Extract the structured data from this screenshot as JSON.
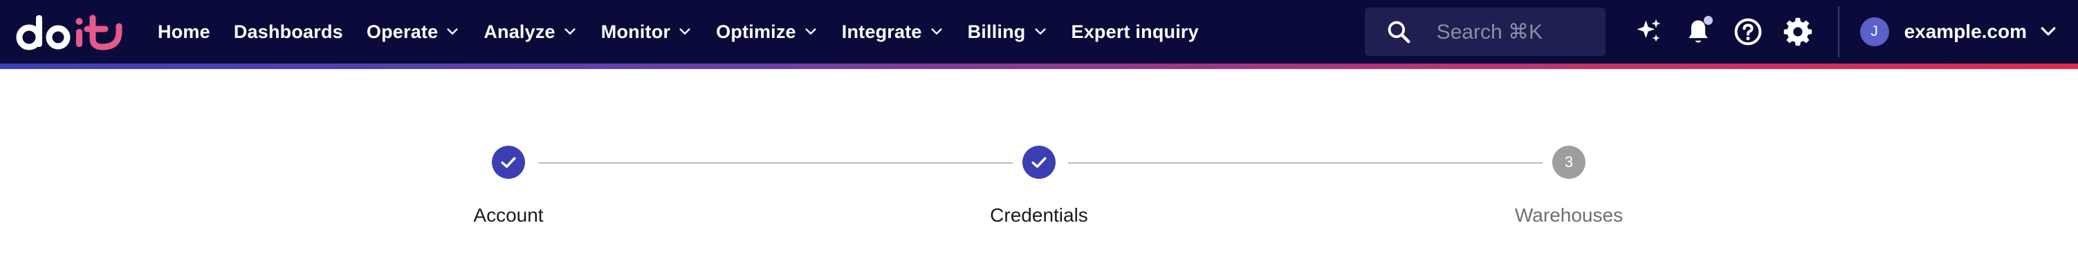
{
  "brand": {
    "logo_text": "doit"
  },
  "nav": {
    "items": [
      {
        "label": "Home",
        "has_menu": false
      },
      {
        "label": "Dashboards",
        "has_menu": false
      },
      {
        "label": "Operate",
        "has_menu": true
      },
      {
        "label": "Analyze",
        "has_menu": true
      },
      {
        "label": "Monitor",
        "has_menu": true
      },
      {
        "label": "Optimize",
        "has_menu": true
      },
      {
        "label": "Integrate",
        "has_menu": true
      },
      {
        "label": "Billing",
        "has_menu": true
      },
      {
        "label": "Expert inquiry",
        "has_menu": false
      }
    ]
  },
  "search": {
    "placeholder": "Search ⌘K",
    "icon": "search-icon"
  },
  "toolbar": {
    "icons": [
      "sparkles-icon",
      "bell-icon",
      "help-icon",
      "gear-icon"
    ],
    "notification_dot": true
  },
  "account": {
    "avatar_initial": "J",
    "name": "example.com"
  },
  "stepper": {
    "steps": [
      {
        "label": "Account",
        "state": "completed"
      },
      {
        "label": "Credentials",
        "state": "completed"
      },
      {
        "number": "3",
        "label": "Warehouses",
        "state": "pending"
      }
    ]
  },
  "colors": {
    "topbar_bg": "#0b0b3b",
    "accent_gradient": [
      "#3c3fb8",
      "#e0294f"
    ],
    "step_complete": "#3b3fb3",
    "step_pending": "#9e9e9e"
  }
}
